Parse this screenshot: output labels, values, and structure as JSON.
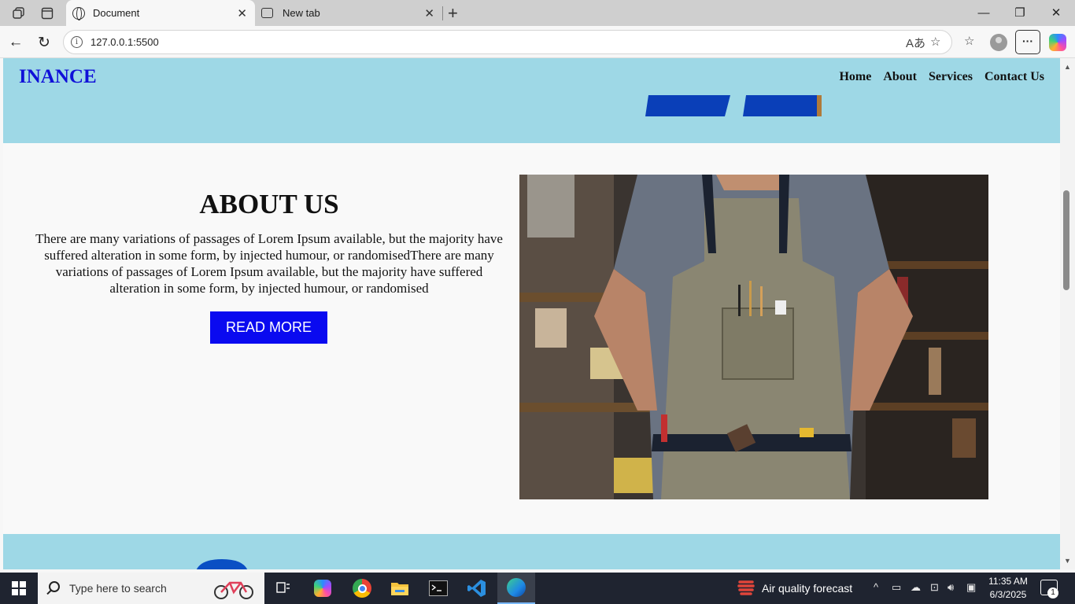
{
  "browser": {
    "tabs": [
      {
        "label": "Document",
        "active": true
      },
      {
        "label": "New tab",
        "active": false
      }
    ],
    "url": "127.0.0.1:5500"
  },
  "site": {
    "logo": "INANCE",
    "nav": [
      "Home",
      "About",
      "Services",
      "Contact Us"
    ],
    "about": {
      "title": "ABOUT US",
      "text": "There are many variations of passages of Lorem Ipsum available, but the majority have suffered alteration in some form, by injected humour, or randomisedThere are many variations of passages of Lorem Ipsum available, but the majority have suffered alteration in some form, by injected humour, or randomised",
      "button": "READ MORE"
    },
    "colors": {
      "section_bg": "#9ed8e6",
      "logo": "#1010d8",
      "button_bg": "#0a0af0"
    }
  },
  "taskbar": {
    "search_placeholder": "Type here to search",
    "weather_text": "Air quality forecast",
    "time": "11:35 AM",
    "date": "6/3/2025",
    "notification_count": "1",
    "apps": [
      "task-view",
      "copilot",
      "chrome",
      "file-explorer",
      "terminal",
      "vscode",
      "edge"
    ]
  }
}
